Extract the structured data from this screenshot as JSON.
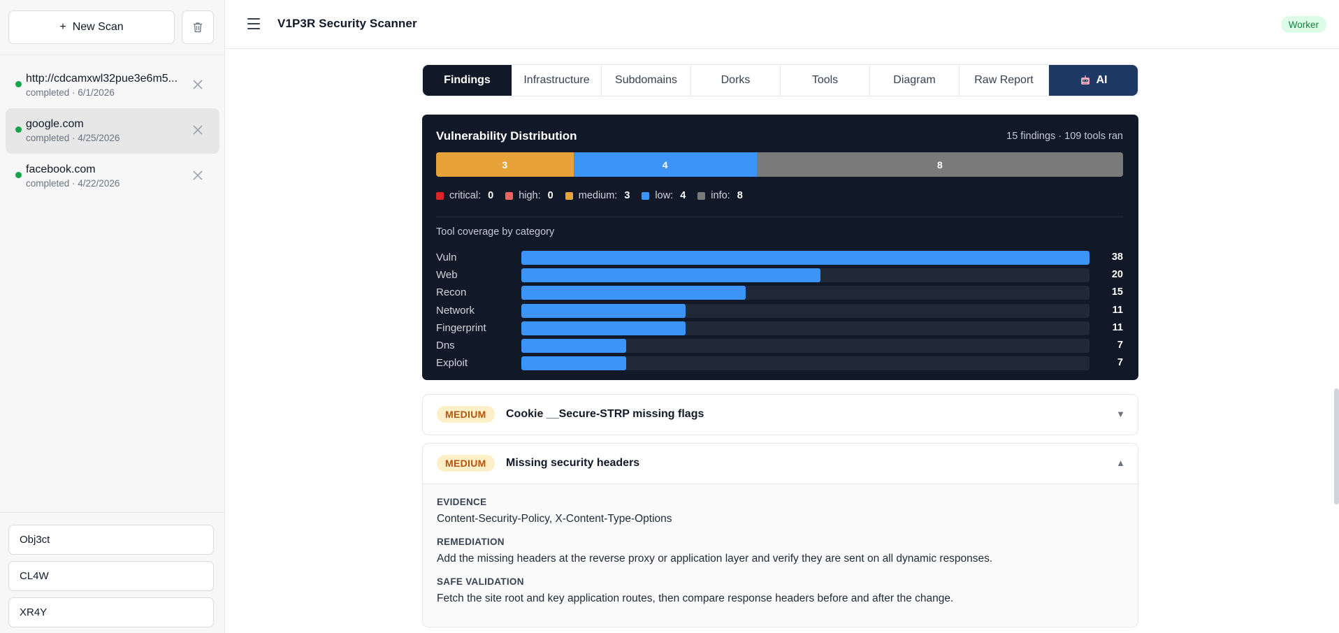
{
  "sidebar": {
    "new_scan_label": "New Scan",
    "scans": [
      {
        "name": "http://cdcamxwl32pue3e6m5...",
        "meta": "completed · 6/1/2026",
        "active": false
      },
      {
        "name": "google.com",
        "meta": "completed · 4/25/2026",
        "active": true
      },
      {
        "name": "facebook.com",
        "meta": "completed · 4/22/2026",
        "active": false
      }
    ],
    "agents": [
      "Obj3ct",
      "CL4W",
      "XR4Y"
    ]
  },
  "header": {
    "title": "V1P3R Security Scanner",
    "badge": "Worker"
  },
  "tabs": [
    {
      "label": "Findings",
      "state": "active"
    },
    {
      "label": "Infrastructure",
      "state": ""
    },
    {
      "label": "Subdomains",
      "state": ""
    },
    {
      "label": "Dorks",
      "state": ""
    },
    {
      "label": "Tools",
      "state": ""
    },
    {
      "label": "Diagram",
      "state": ""
    },
    {
      "label": "Raw Report",
      "state": ""
    },
    {
      "label": "AI",
      "state": "ai"
    }
  ],
  "panel": {
    "title": "Vulnerability Distribution",
    "summary": "15 findings · 109 tools ran",
    "distribution": [
      {
        "key": "medium",
        "value": 3,
        "color": "#e8a23a"
      },
      {
        "key": "low",
        "value": 4,
        "color": "#3b94f6"
      },
      {
        "key": "info",
        "value": 8,
        "color": "#7a7a7a"
      }
    ],
    "legend": [
      {
        "label": "critical:",
        "value": "0",
        "color": "#dc2626"
      },
      {
        "label": "high:",
        "value": "0",
        "color": "#ef6262"
      },
      {
        "label": "medium:",
        "value": "3",
        "color": "#e8a23a"
      },
      {
        "label": "low:",
        "value": "4",
        "color": "#3b94f6"
      },
      {
        "label": "info:",
        "value": "8",
        "color": "#7a7a7a"
      }
    ],
    "coverage_title": "Tool coverage by category",
    "coverage": [
      {
        "label": "Vuln",
        "value": 38
      },
      {
        "label": "Web",
        "value": 20
      },
      {
        "label": "Recon",
        "value": 15
      },
      {
        "label": "Network",
        "value": 11
      },
      {
        "label": "Fingerprint",
        "value": 11
      },
      {
        "label": "Dns",
        "value": 7
      },
      {
        "label": "Exploit",
        "value": 7
      }
    ],
    "coverage_max": 38
  },
  "findings": [
    {
      "severity": "MEDIUM",
      "title": "Cookie __Secure-STRP missing flags",
      "expanded": false
    },
    {
      "severity": "MEDIUM",
      "title": "Missing security headers",
      "expanded": true,
      "evidence_label": "EVIDENCE",
      "evidence": "Content-Security-Policy, X-Content-Type-Options",
      "remediation_label": "REMEDIATION",
      "remediation": "Add the missing headers at the reverse proxy or application layer and verify they are sent on all dynamic responses.",
      "validation_label": "SAFE VALIDATION",
      "validation": "Fetch the site root and key application routes, then compare response headers before and after the change."
    }
  ],
  "icons": {
    "menu": "menu-icon",
    "trash": "trash-icon",
    "close": "close-icon",
    "robot": "robot-icon",
    "expand": "chevron-down-icon",
    "collapse": "chevron-up-icon"
  }
}
